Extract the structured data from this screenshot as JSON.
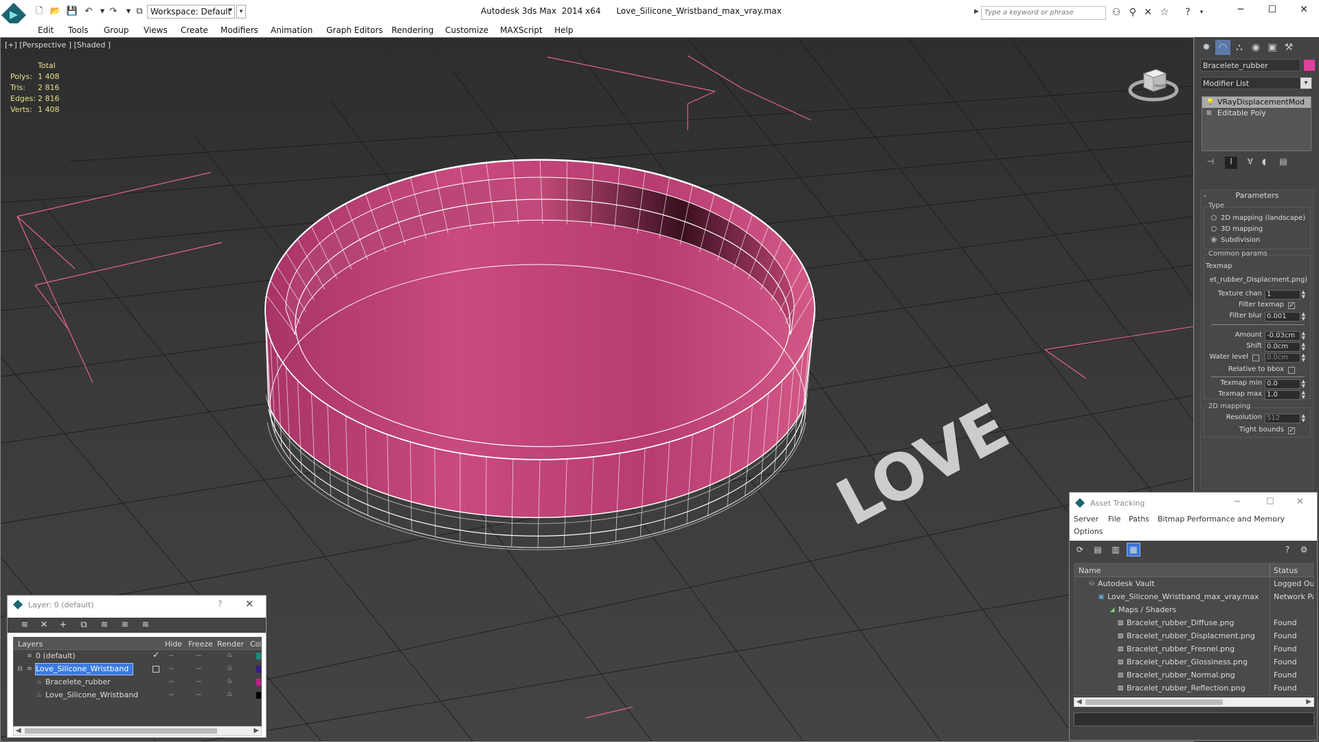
{
  "titlebar": {
    "workspace": "Workspace: Default",
    "title": "Autodesk 3ds Max  2014 x64      Love_Silicone_Wristband_max_vray.max",
    "search_placeholder": "Type a keyword or phrase"
  },
  "menu": [
    "Edit",
    "Tools",
    "Group",
    "Views",
    "Create",
    "Modifiers",
    "Animation",
    "Graph Editors",
    "Rendering",
    "Customize",
    "MAXScript",
    "Help"
  ],
  "viewport": {
    "label": "[+] [Perspective ] [Shaded ]",
    "stats": {
      "header": "Total",
      "rows": [
        {
          "k": "Polys:",
          "v": "1 408"
        },
        {
          "k": "Tris:",
          "v": "2 816"
        },
        {
          "k": "Edges:",
          "v": "2 816"
        },
        {
          "k": "Verts:",
          "v": "1 408"
        }
      ]
    },
    "viewcube_label": "FRONT",
    "object_text": "LOVE",
    "colors": {
      "band": "#c94a7e",
      "band_dark": "#8a2a52",
      "grid": "#555555",
      "light": "#e7648c"
    }
  },
  "command_panel": {
    "object_name": "Bracelete_rubber",
    "object_color": "#e23f9d",
    "modifier_list": "Modifier List",
    "stack": [
      "VRayDisplacementMod",
      "Editable Poly"
    ],
    "params": {
      "title": "Parameters",
      "type_group": "Type",
      "types": [
        "2D mapping (landscape)",
        "3D mapping",
        "Subdivision"
      ],
      "selected_type": "Subdivision",
      "common_group": "Common params",
      "texmap_label": "Texmap",
      "texmap_value": "et_rubber_Displacment.png)",
      "fields": [
        {
          "label": "Texture chan",
          "value": "1"
        },
        {
          "label": "Filter blur",
          "value": "0.001"
        },
        {
          "label": "Amount",
          "value": "-0.03cm"
        },
        {
          "label": "Shift",
          "value": "0.0cm"
        },
        {
          "label": "Water level",
          "value": "0.0cm"
        },
        {
          "label": "Texmap min",
          "value": "0.0"
        },
        {
          "label": "Texmap max",
          "value": "1.0"
        },
        {
          "label": "Resolution",
          "value": "512"
        }
      ],
      "filter_texmap": "Filter texmap",
      "relative_bbox": "Relative to bbox",
      "mapping_group": "2D mapping",
      "tight_bounds": "Tight bounds"
    }
  },
  "layer_dialog": {
    "title": "Layer: 0 (default)",
    "help": "?",
    "columns": [
      "Layers",
      "Hide",
      "Freeze",
      "Render",
      "Col"
    ],
    "rows": [
      {
        "name": "0 (default)",
        "color": "#1a8a78"
      },
      {
        "name": "Love_Silicone_Wristband",
        "color": "#3a1a8a"
      },
      {
        "name": "Bracelete_rubber",
        "color": "#c0208a"
      },
      {
        "name": "Love_Silicone_Wristband",
        "color": "#000000"
      }
    ]
  },
  "asset_dialog": {
    "title": "Asset Tracking",
    "menu": [
      "Server",
      "File",
      "Paths",
      "Bitmap Performance and Memory",
      "Options"
    ],
    "columns": [
      "Name",
      "Status"
    ],
    "rows": [
      {
        "name": "Autodesk Vault",
        "status": "Logged Ou"
      },
      {
        "name": "Love_Silicone_Wristband_max_vray.max",
        "status": "Network Pa"
      },
      {
        "name": "Maps / Shaders",
        "status": ""
      },
      {
        "name": "Bracelet_rubber_Diffuse.png",
        "status": "Found"
      },
      {
        "name": "Bracelet_rubber_Displacment.png",
        "status": "Found"
      },
      {
        "name": "Bracelet_rubber_Fresnel.png",
        "status": "Found"
      },
      {
        "name": "Bracelet_rubber_Glossiness.png",
        "status": "Found"
      },
      {
        "name": "Bracelet_rubber_Normal.png",
        "status": "Found"
      },
      {
        "name": "Bracelet_rubber_Reflection.png",
        "status": "Found"
      }
    ]
  }
}
